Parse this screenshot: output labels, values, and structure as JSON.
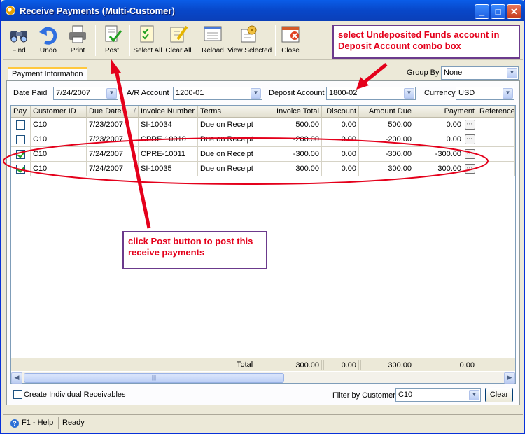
{
  "window": {
    "title": "Receive Payments (Multi-Customer)",
    "min_icon": "minimize-icon",
    "max_icon": "maximize-icon",
    "close_icon": "close-icon"
  },
  "toolbar": {
    "items": [
      {
        "label": "Find",
        "icon": "binoculars-icon"
      },
      {
        "label": "Undo",
        "icon": "undo-arrow-icon"
      },
      {
        "label": "Print",
        "icon": "printer-icon"
      },
      {
        "label": "Post",
        "icon": "post-document-check-icon"
      },
      {
        "label": "Select All",
        "icon": "select-all-check-icon"
      },
      {
        "label": "Clear All",
        "icon": "clear-all-pencil-icon"
      },
      {
        "label": "Reload",
        "icon": "reload-form-icon"
      },
      {
        "label": "View Selected",
        "icon": "view-selected-icon"
      },
      {
        "label": "Close",
        "icon": "close-window-icon"
      }
    ]
  },
  "annotations": {
    "top": "select Undeposited Funds account in Deposit Account combo box",
    "mid": "click Post button to post this receive payments",
    "color": "#e4001b"
  },
  "tab": {
    "label": "Payment Information"
  },
  "group_by": {
    "label": "Group By",
    "value": "None"
  },
  "filters": {
    "date_paid": {
      "label": "Date Paid",
      "value": "7/24/2007"
    },
    "ar_account": {
      "label": "A/R Account",
      "value": "1200-01"
    },
    "deposit_account": {
      "label": "Deposit Account",
      "value": "1800-02"
    },
    "currency": {
      "label": "Currency",
      "value": "USD"
    }
  },
  "grid": {
    "columns": [
      "Pay",
      "Customer ID",
      "Due Date",
      "Invoice Number",
      "Terms",
      "Invoice Total",
      "Discount",
      "Amount Due",
      "Payment",
      "Reference"
    ],
    "rows": [
      {
        "pay": false,
        "customer": "C10",
        "due": "7/23/2007",
        "invoice": "SI-10034",
        "terms": "Due on Receipt",
        "total": "500.00",
        "discount": "0.00",
        "amount_due": "500.00",
        "payment": "0.00"
      },
      {
        "pay": false,
        "customer": "C10",
        "due": "7/23/2007",
        "invoice": "CPRE-10010",
        "terms": "Due on Receipt",
        "total": "-200.00",
        "discount": "0.00",
        "amount_due": "-200.00",
        "payment": "0.00"
      },
      {
        "pay": true,
        "customer": "C10",
        "due": "7/24/2007",
        "invoice": "CPRE-10011",
        "terms": "Due on Receipt",
        "total": "-300.00",
        "discount": "0.00",
        "amount_due": "-300.00",
        "payment": "-300.00"
      },
      {
        "pay": true,
        "customer": "C10",
        "due": "7/24/2007",
        "invoice": "SI-10035",
        "terms": "Due on Receipt",
        "total": "300.00",
        "discount": "0.00",
        "amount_due": "300.00",
        "payment": "300.00"
      }
    ],
    "totals": {
      "label": "Total",
      "invoice_total": "300.00",
      "discount": "0.00",
      "amount_due": "300.00",
      "payment": "0.00"
    },
    "ellipsis": "···",
    "sort_indicator": "/"
  },
  "bottom": {
    "create_individual": "Create Individual Receivables",
    "filter_label": "Filter by Customer",
    "filter_value": "C10",
    "clear_button": "Clear"
  },
  "status": {
    "help": "F1 - Help",
    "state": "Ready"
  }
}
